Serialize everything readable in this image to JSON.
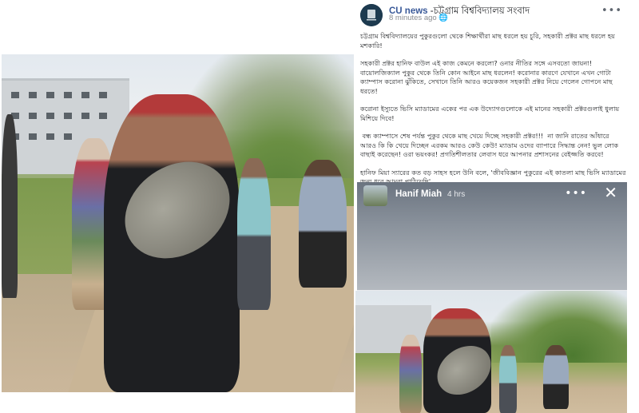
{
  "post": {
    "page_name_en": "CU news",
    "page_name_bn": "-চট্টগ্রাম বিশ্ববিদ্যালয় সংবাদ",
    "time": "8 minutes ago",
    "time_icon": "globe-icon",
    "paragraphs": [
      "চট্টগ্রাম বিশ্ববিদ্যালয়ের পুকুরগুলো থেকে শিক্ষার্থীরা মাছ ধরলে হয় চুরি, সহকারী প্রক্টর মাছ ধরলে হয় মশকারি!",
      "সহকারী প্রক্টর হানিফ বাউল এই কাজ কেমনে করলো? ওনার নীতির সঙ্গে এসবতো জায়না! বায়োলজিক্যাল পুকুর থেকে তিনি কোন আইনে মাছ ধরলেন! করোনার কারণে যেখানে এখন গোটা ক্যাম্পাস করোনা ঝুঁকিতে, সেখানে তিনি আরও কয়েকজন সহকারী প্রক্টর নিয়ে গেলেন গোপনে মাছ ধরতে!",
      "করোনা ইস্যুতে ভিসি ম্যাডামের একের পর এক উদ্যোগগুলোকে এই মানের সহকারী প্রক্টরগুলাই ধুলায় মিশিয়ে দিবে!",
      " বন্ধ ক্যাম্পাসে শেষ পর্যন্ত পুকুর থেকে মাছ খেয়ে দিচ্ছে সহকারী প্রক্টর!!!  না জানি রাতের আঁধারে আরও কি কি খেয়ে দিচ্ছেন এরকম আরও কেউ কেউ! ম্যাডাম ওদের ব্যাপারে সিদ্ধান্ত নেন! ভুল লোক বাছাই করেছেন! ওরা ভয়ংকর! প্রগতিশীলতার লেবাস ধরে আপনার প্রশাসনের বেইজ্জতি করবে!",
      "হানিফ মিয়া স্যারের কত বড় সাহস হলে উনি বলে, 'জীববিজ্ঞান পুকুরের এই কাতলা মাছ ভিসি ম্যাডামের জন্য ধরে আমরা পাঠিয়েছি'"
    ]
  },
  "viewer": {
    "name": "Hanif Miah",
    "time": "4 hrs",
    "more_icon": "more-dots-icon",
    "close_icon": "close-icon"
  },
  "colors": {
    "page_name": "#385898",
    "text": "#1c1e21",
    "meta": "#8a8d91"
  }
}
